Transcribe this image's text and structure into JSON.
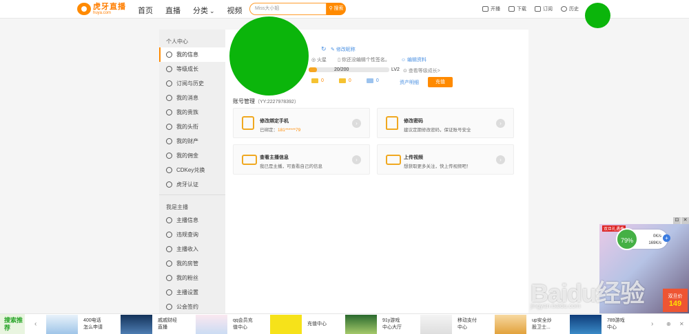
{
  "header": {
    "logo_cn": "虎牙直播",
    "logo_en": "huya.com",
    "nav": [
      "首页",
      "直播",
      "分类",
      "视频"
    ],
    "search_placeholder": "Miss大小姐",
    "search_button": "搜索",
    "actions": [
      "开播",
      "下载",
      "订阅",
      "历史"
    ]
  },
  "sidebar": {
    "group1_title": "个人中心",
    "group1_items": [
      "我的信息",
      "等级成长",
      "订阅与历史",
      "我的消息",
      "我的贵族",
      "我的头衔",
      "我的财产",
      "我的佣金",
      "CDKey兑换",
      "虎牙认证"
    ],
    "group2_title": "我是主播",
    "group2_items": [
      "主播信息",
      "违规查询",
      "主播收入",
      "我的房管",
      "我的粉丝",
      "主播设置",
      "公会签约"
    ],
    "active_index": 0
  },
  "profile": {
    "edit_nick": "修改昵称",
    "meta_star": "火星",
    "meta_sign": "你还没编辑个性签名。",
    "meta_edit": "编辑资料",
    "exp": "20/200",
    "exp_progress": 0.1,
    "level": "LV2",
    "level_link": "查看等级成长>",
    "coins": [
      "0",
      "0",
      "0"
    ],
    "asset_link": "资产明细",
    "recharge": "充值"
  },
  "account": {
    "title": "账号管理",
    "uid": "（YY:2227978392）",
    "cards": [
      {
        "title": "修改绑定手机",
        "desc_prefix": "已绑定：",
        "desc_value": "181******79",
        "icon": "phone-icon"
      },
      {
        "title": "修改密码",
        "desc_prefix": "建议定期修改密码，保证账号安全",
        "desc_value": "",
        "icon": "lock-icon"
      },
      {
        "title": "查看主播信息",
        "desc_prefix": "我已是主播，可查看自己的信息",
        "desc_value": "",
        "icon": "anchor-icon"
      },
      {
        "title": "上传视频",
        "desc_prefix": "想获取更多关注，快上传视频吧！",
        "desc_value": "",
        "icon": "video-icon"
      }
    ]
  },
  "bottom_bar": {
    "tag": "搜索推荐",
    "items": [
      {
        "l1": "400电话",
        "l2": "怎么申请"
      },
      {
        "l1": "戚戚财经",
        "l2": "直播"
      },
      {
        "l1": "qq会员充",
        "l2": "值中心"
      },
      {
        "l1": "充值中心",
        "l2": ""
      },
      {
        "l1": "91y游戏",
        "l2": "中心大厅"
      },
      {
        "l1": "移动支付",
        "l2": "中心"
      },
      {
        "l1": "up安全炒",
        "l2": "股卫士..."
      },
      {
        "l1": "789游戏",
        "l2": "中心"
      }
    ]
  },
  "float_ad": {
    "tag": "双旦礼遇季",
    "price_label": "双旦价",
    "price_value": "149",
    "speed_percent": "79%",
    "up_speed": "0K/s",
    "down_speed": "169K/s"
  },
  "watermark": {
    "main": "Baidu经验",
    "sub": "jingyan.baidu.com"
  }
}
